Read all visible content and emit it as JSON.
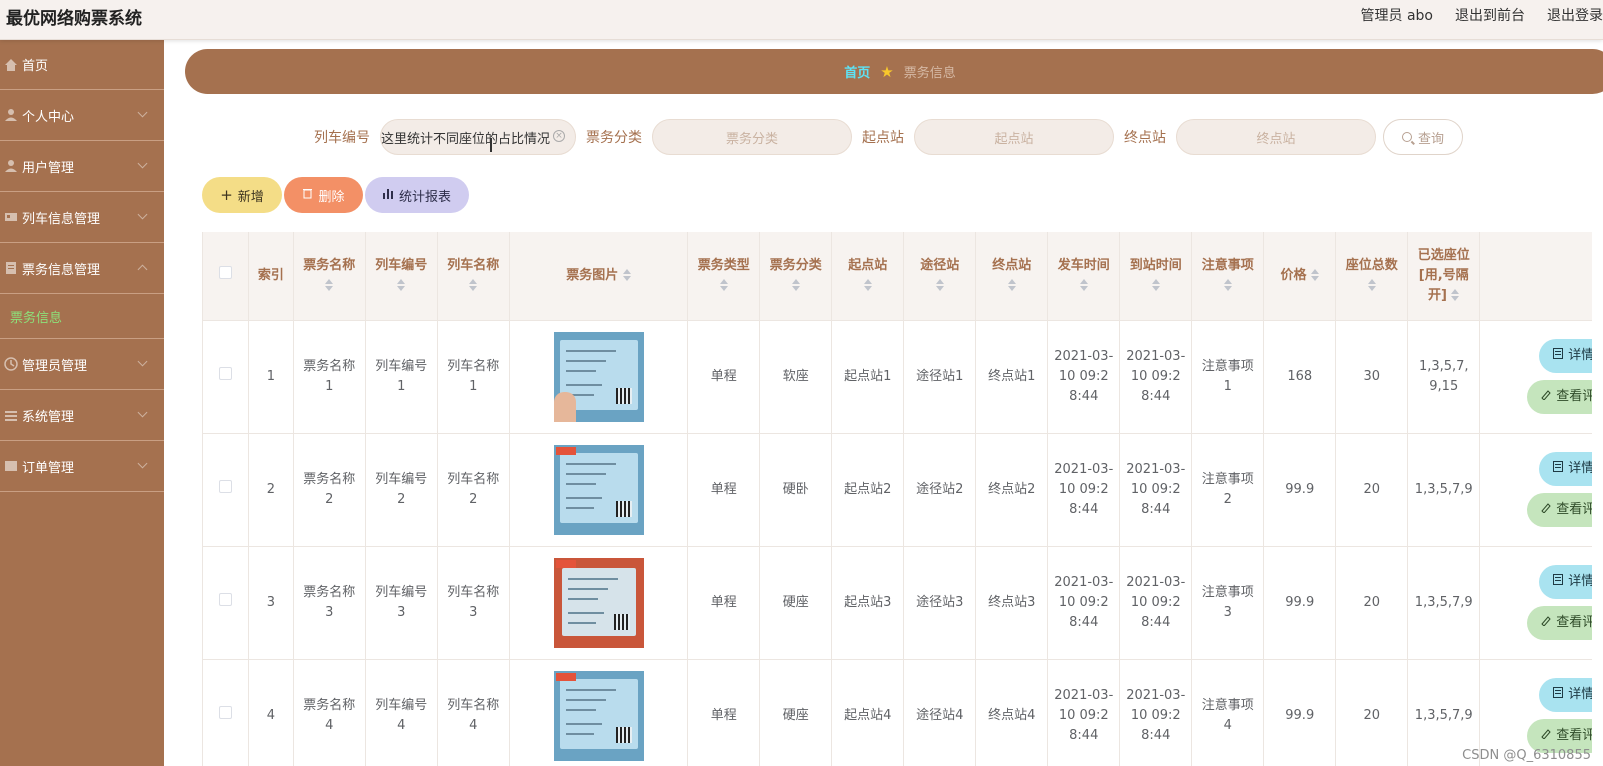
{
  "app": {
    "title": "最优网络购票系统",
    "admin_label": "管理员 abo",
    "to_front": "退出到前台",
    "logout": "退出登录"
  },
  "sidebar": {
    "items": [
      {
        "label": "首页",
        "icon": "home-icon"
      },
      {
        "label": "个人中心",
        "icon": "user-icon"
      },
      {
        "label": "用户管理",
        "icon": "users-icon"
      },
      {
        "label": "列车信息管理",
        "icon": "train-icon"
      },
      {
        "label": "票务信息管理",
        "icon": "ticket-icon"
      },
      {
        "label": "管理员管理",
        "icon": "admin-icon"
      },
      {
        "label": "系统管理",
        "icon": "settings-icon"
      },
      {
        "label": "订单管理",
        "icon": "order-icon"
      }
    ],
    "active_sub": "票务信息"
  },
  "breadcrumb": {
    "home": "首页",
    "current": "票务信息"
  },
  "search": {
    "train_no_label": "列车编号",
    "train_no_value": "这里统计不同座位的占比情况",
    "category_label": "票务分类",
    "category_placeholder": "票务分类",
    "start_label": "起点站",
    "start_placeholder": "起点站",
    "end_label": "终点站",
    "end_placeholder": "终点站",
    "query_label": "查询"
  },
  "actions": {
    "add": "新增",
    "delete": "删除",
    "stats": "统计报表"
  },
  "table": {
    "headers": {
      "index": "索引",
      "name": "票务名称",
      "train_no": "列车编号",
      "train_name": "列车名称",
      "image": "票务图片",
      "type": "票务类型",
      "category": "票务分类",
      "start": "起点站",
      "via": "途径站",
      "end": "终点站",
      "depart": "发车时间",
      "arrive": "到站时间",
      "notes": "注意事项",
      "price": "价格",
      "seats": "座位总数",
      "selected": "已选座位[用,号隔开]"
    },
    "detail_label": "详情",
    "view_label": "查看评",
    "rows": [
      {
        "index": "1",
        "name": "票务名称1",
        "train_no": "列车编号1",
        "train_name": "列车名称1",
        "type": "单程",
        "category": "软座",
        "start": "起点站1",
        "via": "途径站1",
        "end": "终点站1",
        "depart": "2021-03-10 09:28:44",
        "arrive": "2021-03-10 09:28:44",
        "notes": "注意事项1",
        "price": "168",
        "seats": "30",
        "selected": "1,3,5,7,9,15"
      },
      {
        "index": "2",
        "name": "票务名称2",
        "train_no": "列车编号2",
        "train_name": "列车名称2",
        "type": "单程",
        "category": "硬卧",
        "start": "起点站2",
        "via": "途径站2",
        "end": "终点站2",
        "depart": "2021-03-10 09:28:44",
        "arrive": "2021-03-10 09:28:44",
        "notes": "注意事项2",
        "price": "99.9",
        "seats": "20",
        "selected": "1,3,5,7,9"
      },
      {
        "index": "3",
        "name": "票务名称3",
        "train_no": "列车编号3",
        "train_name": "列车名称3",
        "type": "单程",
        "category": "硬座",
        "start": "起点站3",
        "via": "途径站3",
        "end": "终点站3",
        "depart": "2021-03-10 09:28:44",
        "arrive": "2021-03-10 09:28:44",
        "notes": "注意事项3",
        "price": "99.9",
        "seats": "20",
        "selected": "1,3,5,7,9"
      },
      {
        "index": "4",
        "name": "票务名称4",
        "train_no": "列车编号4",
        "train_name": "列车名称4",
        "type": "单程",
        "category": "硬座",
        "start": "起点站4",
        "via": "途径站4",
        "end": "终点站4",
        "depart": "2021-03-10 09:28:44",
        "arrive": "2021-03-10 09:28:44",
        "notes": "注意事项4",
        "price": "99.9",
        "seats": "20",
        "selected": "1,3,5,7,9"
      }
    ]
  },
  "watermark": "CSDN @Q_6310855",
  "colors": {
    "primary": "#a5714f",
    "add": "#f4dd87",
    "delete": "#f39066",
    "stats": "#d0ccf0",
    "detail": "#a9e3f0",
    "view": "#c5e5bd",
    "active_sub": "#8de07a"
  }
}
